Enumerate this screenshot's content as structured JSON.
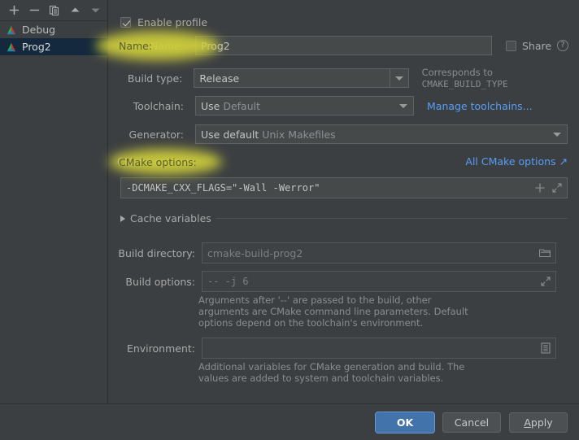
{
  "sidebar": {
    "toolbar": [
      {
        "name": "add-profile-button",
        "icon": "plus-icon"
      },
      {
        "name": "remove-profile-button",
        "icon": "minus-icon"
      },
      {
        "name": "copy-profile-button",
        "icon": "copy-icon"
      },
      {
        "name": "move-up-button",
        "icon": "arrow-up-icon"
      },
      {
        "name": "move-down-button",
        "icon": "arrow-down-icon"
      }
    ],
    "profiles": [
      {
        "label": "Debug",
        "selected": false
      },
      {
        "label": "Prog2",
        "selected": true
      }
    ]
  },
  "form": {
    "enable_profile": {
      "label": "Enable profile",
      "checked": true
    },
    "name": {
      "label": "Name:",
      "value": "Prog2",
      "highlighted": true
    },
    "share": {
      "label": "Share",
      "checked": false,
      "help_icon": "question-mark-icon"
    },
    "build_type": {
      "label": "Build type:",
      "value": "Release",
      "hint_prefix": "Corresponds to ",
      "hint_mono": "CMAKE_BUILD_TYPE"
    },
    "toolchain": {
      "label": "Toolchain:",
      "value": "Use",
      "value_secondary": "Default",
      "link": "Manage toolchains..."
    },
    "generator": {
      "label": "Generator:",
      "value": "Use default",
      "value_secondary": "Unix Makefiles"
    },
    "cmake_options": {
      "label": "CMake options:",
      "highlighted": true,
      "link": "All CMake options ↗",
      "value": "-DCMAKE_CXX_FLAGS=\"-Wall -Werror\"",
      "icons": [
        "plus-icon",
        "expand-icon"
      ]
    },
    "cache_variables": {
      "label": "Cache variables",
      "expanded": false
    },
    "build_directory": {
      "label": "Build directory:",
      "placeholder": "cmake-build-prog2",
      "icon": "folder-icon"
    },
    "build_options": {
      "label": "Build options:",
      "placeholder": "--  -j  6",
      "icon": "expand-icon",
      "help": "Arguments after '--' are passed to the build, other arguments are CMake command line parameters. Default options depend on the toolchain's environment."
    },
    "environment": {
      "label": "Environment:",
      "value": "",
      "icon": "list-editor-icon",
      "help": "Additional variables for CMake generation and build. The values are added to system and toolchain variables."
    }
  },
  "buttons": {
    "ok": "OK",
    "cancel": "Cancel",
    "apply_mnemonic": "A",
    "apply_rest": "pply"
  },
  "colors": {
    "background": "#3c3f41",
    "selection": "#14293d",
    "link": "#589df6",
    "primary_button": "#4373ab",
    "highlight": "#cfcf3c"
  }
}
